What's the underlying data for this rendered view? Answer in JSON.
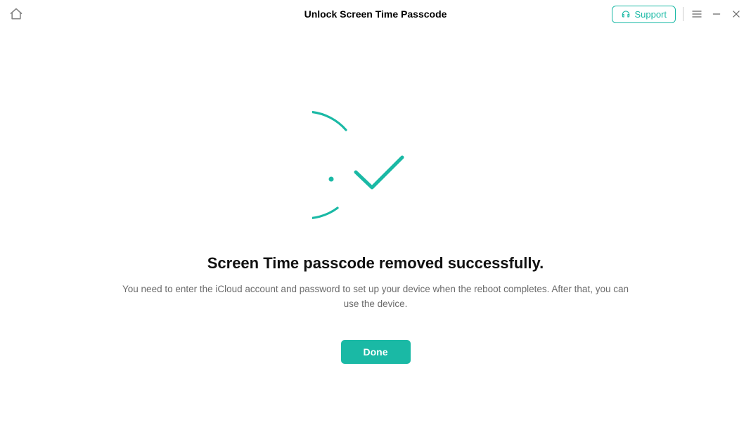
{
  "titlebar": {
    "title": "Unlock Screen Time Passcode",
    "support_label": "Support"
  },
  "main": {
    "heading": "Screen Time passcode removed successfully.",
    "subtext": "You need to enter the iCloud account and password to set up your device when the reboot completes. After that, you can use the device.",
    "done_label": "Done"
  },
  "colors": {
    "accent": "#1ab9a5"
  }
}
